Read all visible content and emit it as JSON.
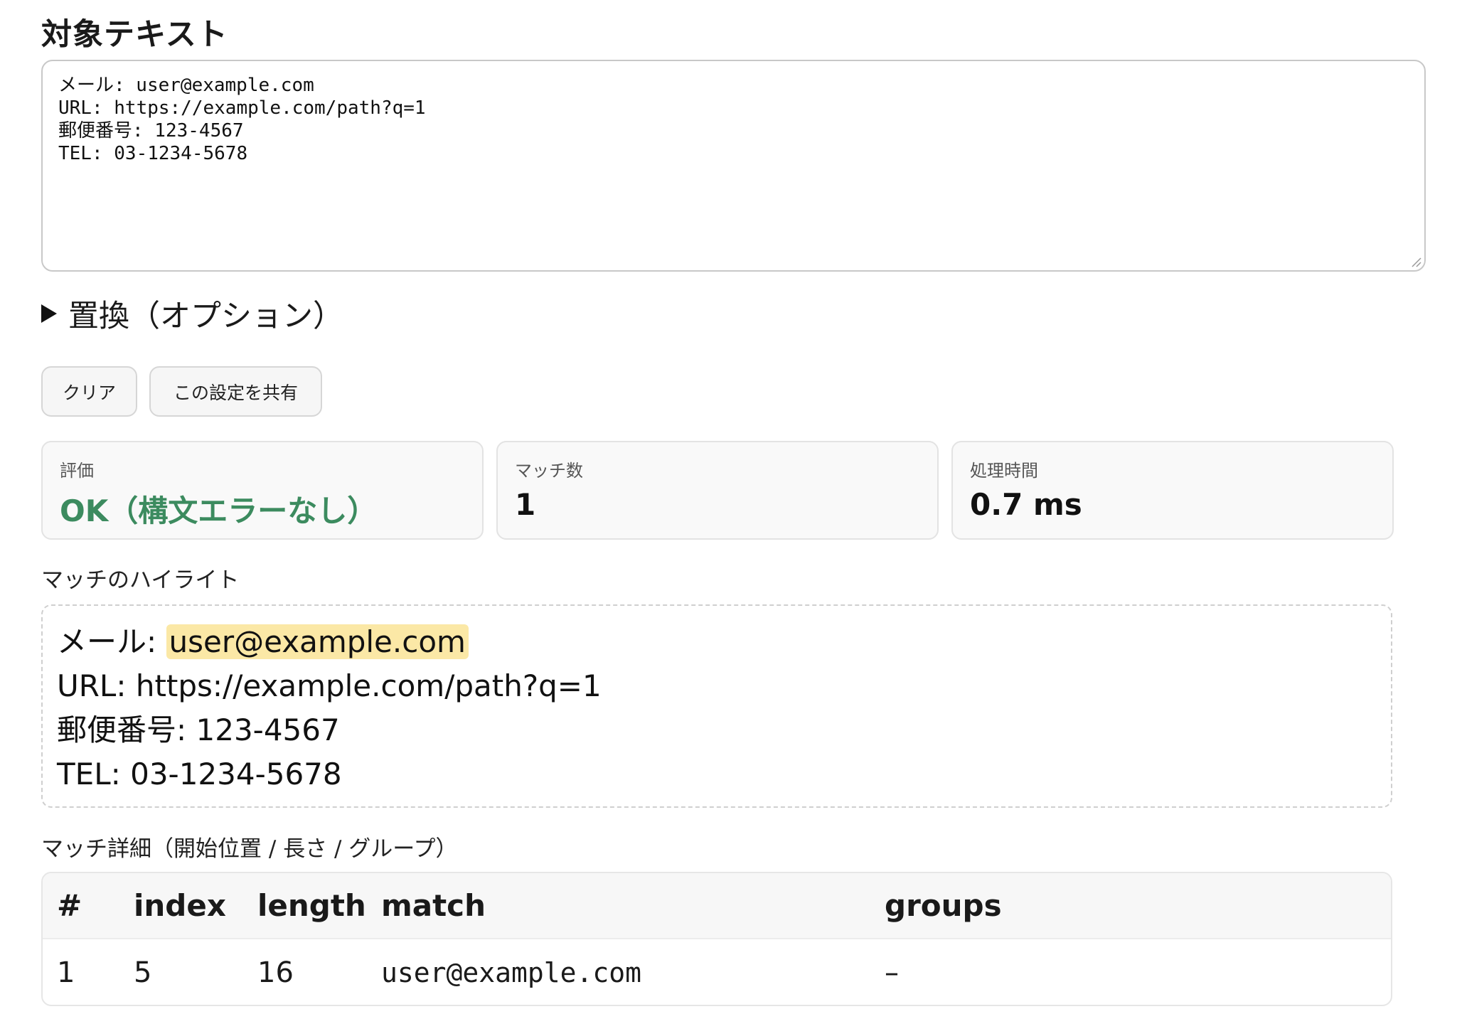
{
  "target_section": {
    "heading": "対象テキスト",
    "text": "メール: user@example.com\nURL: https://example.com/path?q=1\n郵便番号: 123-4567\nTEL: 03-1234-5678"
  },
  "replace_section": {
    "summary": "置換（オプション）",
    "expanded": false
  },
  "buttons": {
    "clear_label": "クリア",
    "share_label": "この設定を共有"
  },
  "stats": {
    "evaluation_label": "評価",
    "evaluation_value": "OK（構文エラーなし）",
    "match_count_label": "マッチ数",
    "match_count_value": "1",
    "time_label": "処理時間",
    "time_value": "0.7 ms"
  },
  "highlight": {
    "label": "マッチのハイライト",
    "lines": [
      {
        "before": "メール: ",
        "match": "user@example.com",
        "after": ""
      },
      {
        "before": "URL: https://example.com/path?q=1",
        "match": "",
        "after": ""
      },
      {
        "before": "郵便番号: 123-4567",
        "match": "",
        "after": ""
      },
      {
        "before": "TEL: 03-1234-5678",
        "match": "",
        "after": ""
      }
    ]
  },
  "details": {
    "label": "マッチ詳細（開始位置 / 長さ / グループ）",
    "columns": [
      "#",
      "index",
      "length",
      "match",
      "groups"
    ],
    "rows": [
      {
        "num": "1",
        "index": "5",
        "length": "16",
        "match": "user@example.com",
        "groups": "–"
      }
    ]
  },
  "colors": {
    "ok_green": "#3c8b5f",
    "highlight_yellow": "#fbe8a6"
  }
}
